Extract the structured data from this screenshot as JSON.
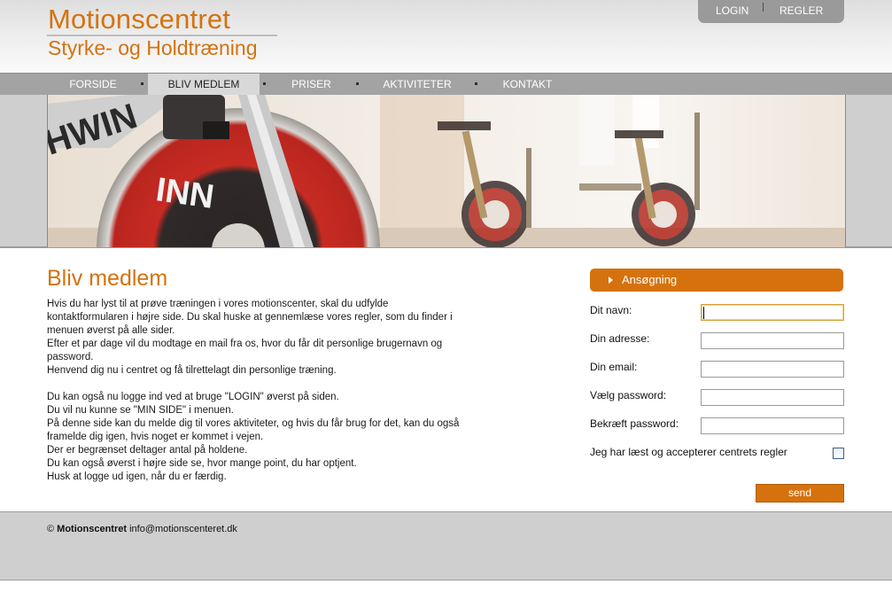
{
  "header": {
    "title": "Motionscentret",
    "subtitle": "Styrke- og Holdtræning",
    "top_links": {
      "login": "LOGIN",
      "regler": "REGLER"
    }
  },
  "nav": {
    "items": [
      {
        "label": "FORSIDE",
        "active": false
      },
      {
        "label": "BLIV MEDLEM",
        "active": true
      },
      {
        "label": "PRISER",
        "active": false
      },
      {
        "label": "AKTIVITETER",
        "active": false
      },
      {
        "label": "KONTAKT",
        "active": false
      }
    ]
  },
  "main": {
    "title": "Bliv medlem",
    "paragraph1": [
      "Hvis du har lyst til at prøve træningen i vores motionscenter, skal du udfylde",
      "kontaktformularen i højre side. Du skal huske at gennemlæse vores regler, som du finder i",
      "menuen øverst på alle sider.",
      "Efter et par dage vil du modtage en mail fra os, hvor du får dit personlige brugernavn og",
      "password.",
      "Henvend dig nu i centret og få tilrettelagt din personlige træning."
    ],
    "paragraph2": [
      "Du kan også nu logge ind ved at bruge \"LOGIN\" øverst på siden.",
      "Du vil nu kunne se \"MIN SIDE\" i menuen.",
      "På denne side kan du melde dig til vores aktiviteter, og hvis du får brug for det, kan du også",
      "framelde dig igen, hvis noget er kommet i vejen.",
      "Der er begrænset deltager antal på holdene.",
      "Du kan også øverst i højre side se, hvor mange point, du har optjent.",
      "Husk at logge ud igen, når du er færdig."
    ]
  },
  "form": {
    "header": "Ansøgning",
    "fields": {
      "name": {
        "label": "Dit navn:",
        "value": ""
      },
      "address": {
        "label": "Din adresse:",
        "value": ""
      },
      "email": {
        "label": "Din email:",
        "value": ""
      },
      "password": {
        "label": "Vælg password:",
        "value": ""
      },
      "confirm": {
        "label": "Bekræft password:",
        "value": ""
      }
    },
    "rules_label": "Jeg har læst og accepterer centrets regler",
    "rules_checked": false,
    "submit": "send"
  },
  "footer": {
    "copyright_symbol": "©",
    "brand": "Motionscentret",
    "email": "info@motionscenteret.dk"
  },
  "colors": {
    "accent": "#d5720e",
    "nav_bg": "#a3a3a3",
    "nav_active_bg": "#d8d8d8",
    "band_bg": "#cfcfcf"
  },
  "icons": {
    "form_header": "triangle-right-icon",
    "hero": "spinning-bikes-photo"
  }
}
